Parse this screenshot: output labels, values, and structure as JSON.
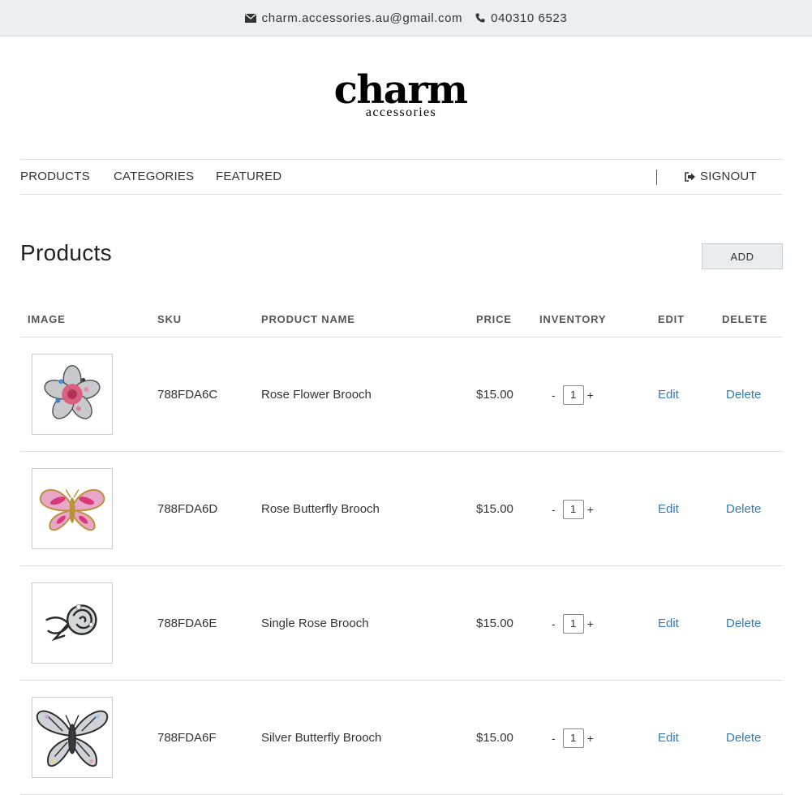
{
  "topbar": {
    "email": "charm.accessories.au@gmail.com",
    "phone": "040310 6523",
    "email_icon": "envelope-icon",
    "phone_icon": "phone-icon"
  },
  "logo": {
    "main": "charm",
    "sub": "accessories"
  },
  "nav": {
    "items": [
      "PRODUCTS",
      "CATEGORIES",
      "FEATURED"
    ],
    "signout": "SIGNOUT",
    "signout_icon": "sign-out-icon"
  },
  "page": {
    "title": "Products",
    "add_label": "ADD"
  },
  "table": {
    "headers": [
      "IMAGE",
      "SKU",
      "PRODUCT NAME",
      "PRICE",
      "INVENTORY",
      "EDIT",
      "DELETE"
    ],
    "rows": [
      {
        "image_icon": "rose-flower-brooch-image",
        "sku": "788FDA6C",
        "name": "Rose Flower Brooch",
        "price": "$15.00",
        "qty": "1",
        "minus": "-",
        "plus": "+",
        "edit": "Edit",
        "delete": "Delete"
      },
      {
        "image_icon": "rose-butterfly-brooch-image",
        "sku": "788FDA6D",
        "name": "Rose Butterfly Brooch",
        "price": "$15.00",
        "qty": "1",
        "minus": "-",
        "plus": "+",
        "edit": "Edit",
        "delete": "Delete"
      },
      {
        "image_icon": "single-rose-brooch-image",
        "sku": "788FDA6E",
        "name": "Single Rose Brooch",
        "price": "$15.00",
        "qty": "1",
        "minus": "-",
        "plus": "+",
        "edit": "Edit",
        "delete": "Delete"
      },
      {
        "image_icon": "silver-butterfly-brooch-image",
        "sku": "788FDA6F",
        "name": "Silver Butterfly Brooch",
        "price": "$15.00",
        "qty": "1",
        "minus": "-",
        "plus": "+",
        "edit": "Edit",
        "delete": "Delete"
      }
    ]
  },
  "colors": {
    "link": "#337ab7",
    "topbar_bg": "#eceff2",
    "add_button_bg": "#e9edf0"
  }
}
